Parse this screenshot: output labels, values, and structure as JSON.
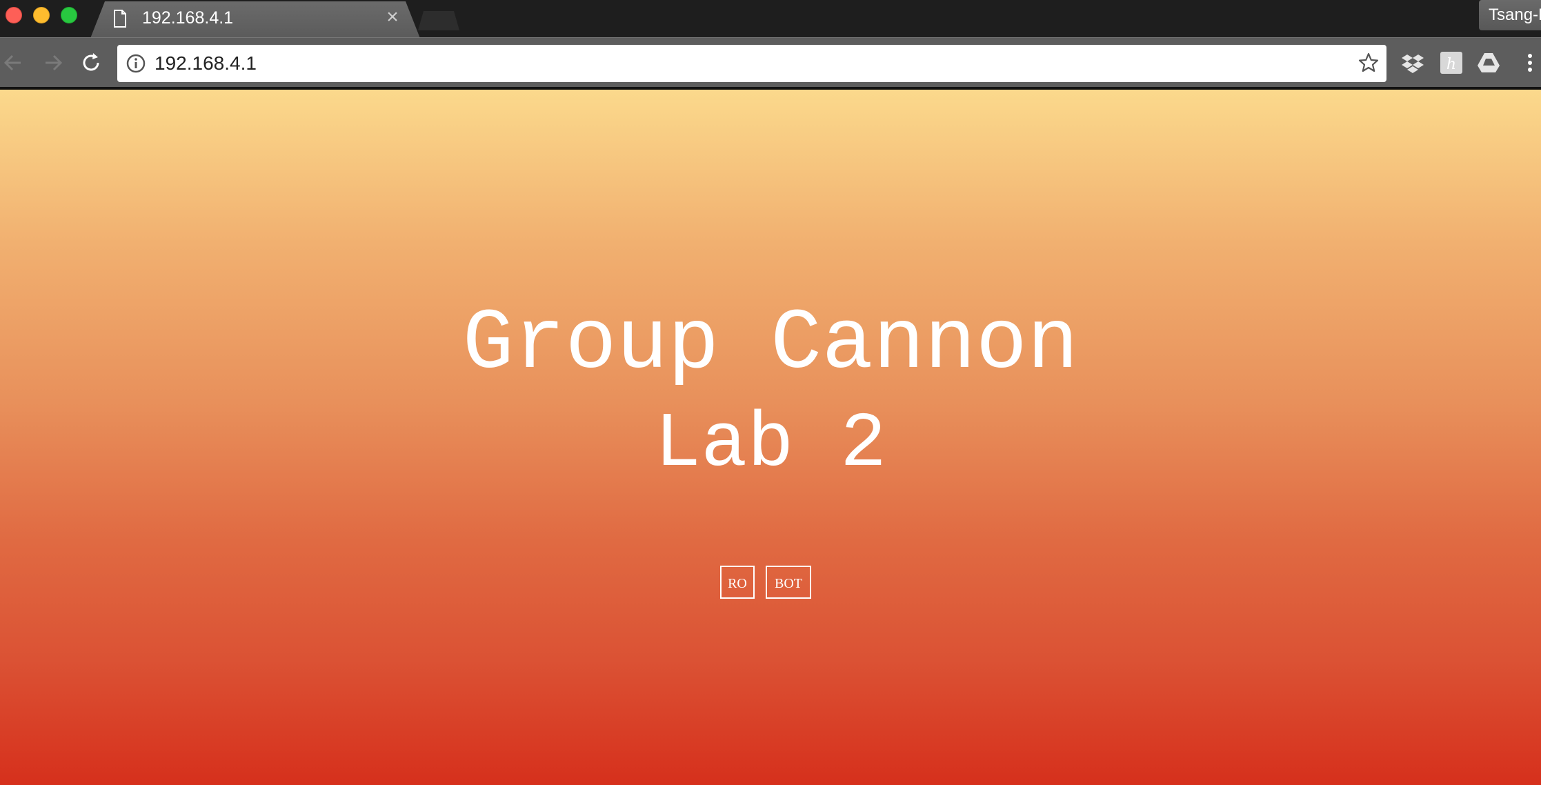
{
  "browser": {
    "tab": {
      "title": "192.168.4.1",
      "close_glyph": "×",
      "icon": "document-icon"
    },
    "profile": {
      "name": "Tsang-Kai"
    },
    "toolbar": {
      "url": "192.168.4.1",
      "icons": [
        "back-icon",
        "forward-icon",
        "reload-icon",
        "info-icon",
        "star-icon",
        "dropbox-icon",
        "honey-icon",
        "google-drive-icon",
        "menu-icon"
      ]
    },
    "window_controls": {
      "close_color": "#fd5f57",
      "minimize_color": "#febc2e",
      "maximize_color": "#28c840"
    }
  },
  "page": {
    "title_line1": "Group Cannon",
    "title_line2": "Lab 2",
    "buttons": [
      {
        "label": "RO"
      },
      {
        "label": "BOT"
      }
    ],
    "gradient": {
      "top": "#fbd98c",
      "bottom": "#d6301c"
    },
    "text_color": "#ffffff"
  }
}
